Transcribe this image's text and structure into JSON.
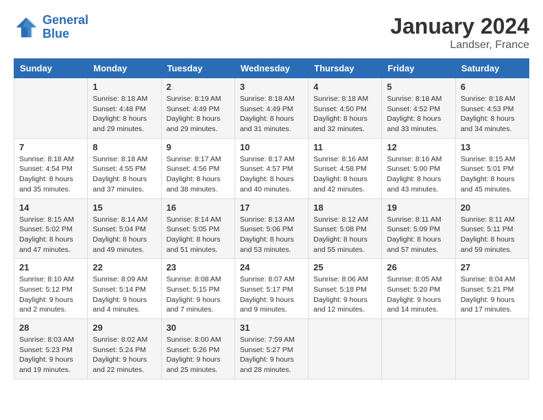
{
  "header": {
    "logo_line1": "General",
    "logo_line2": "Blue",
    "month": "January 2024",
    "location": "Landser, France"
  },
  "days_of_week": [
    "Sunday",
    "Monday",
    "Tuesday",
    "Wednesday",
    "Thursday",
    "Friday",
    "Saturday"
  ],
  "weeks": [
    [
      {
        "day": "",
        "info": ""
      },
      {
        "day": "1",
        "info": "Sunrise: 8:18 AM\nSunset: 4:48 PM\nDaylight: 8 hours\nand 29 minutes."
      },
      {
        "day": "2",
        "info": "Sunrise: 8:19 AM\nSunset: 4:49 PM\nDaylight: 8 hours\nand 29 minutes."
      },
      {
        "day": "3",
        "info": "Sunrise: 8:18 AM\nSunset: 4:49 PM\nDaylight: 8 hours\nand 31 minutes."
      },
      {
        "day": "4",
        "info": "Sunrise: 8:18 AM\nSunset: 4:50 PM\nDaylight: 8 hours\nand 32 minutes."
      },
      {
        "day": "5",
        "info": "Sunrise: 8:18 AM\nSunset: 4:52 PM\nDaylight: 8 hours\nand 33 minutes."
      },
      {
        "day": "6",
        "info": "Sunrise: 8:18 AM\nSunset: 4:53 PM\nDaylight: 8 hours\nand 34 minutes."
      }
    ],
    [
      {
        "day": "7",
        "info": "Sunrise: 8:18 AM\nSunset: 4:54 PM\nDaylight: 8 hours\nand 35 minutes."
      },
      {
        "day": "8",
        "info": "Sunrise: 8:18 AM\nSunset: 4:55 PM\nDaylight: 8 hours\nand 37 minutes."
      },
      {
        "day": "9",
        "info": "Sunrise: 8:17 AM\nSunset: 4:56 PM\nDaylight: 8 hours\nand 38 minutes."
      },
      {
        "day": "10",
        "info": "Sunrise: 8:17 AM\nSunset: 4:57 PM\nDaylight: 8 hours\nand 40 minutes."
      },
      {
        "day": "11",
        "info": "Sunrise: 8:16 AM\nSunset: 4:58 PM\nDaylight: 8 hours\nand 42 minutes."
      },
      {
        "day": "12",
        "info": "Sunrise: 8:16 AM\nSunset: 5:00 PM\nDaylight: 8 hours\nand 43 minutes."
      },
      {
        "day": "13",
        "info": "Sunrise: 8:15 AM\nSunset: 5:01 PM\nDaylight: 8 hours\nand 45 minutes."
      }
    ],
    [
      {
        "day": "14",
        "info": "Sunrise: 8:15 AM\nSunset: 5:02 PM\nDaylight: 8 hours\nand 47 minutes."
      },
      {
        "day": "15",
        "info": "Sunrise: 8:14 AM\nSunset: 5:04 PM\nDaylight: 8 hours\nand 49 minutes."
      },
      {
        "day": "16",
        "info": "Sunrise: 8:14 AM\nSunset: 5:05 PM\nDaylight: 8 hours\nand 51 minutes."
      },
      {
        "day": "17",
        "info": "Sunrise: 8:13 AM\nSunset: 5:06 PM\nDaylight: 8 hours\nand 53 minutes."
      },
      {
        "day": "18",
        "info": "Sunrise: 8:12 AM\nSunset: 5:08 PM\nDaylight: 8 hours\nand 55 minutes."
      },
      {
        "day": "19",
        "info": "Sunrise: 8:11 AM\nSunset: 5:09 PM\nDaylight: 8 hours\nand 57 minutes."
      },
      {
        "day": "20",
        "info": "Sunrise: 8:11 AM\nSunset: 5:11 PM\nDaylight: 8 hours\nand 59 minutes."
      }
    ],
    [
      {
        "day": "21",
        "info": "Sunrise: 8:10 AM\nSunset: 5:12 PM\nDaylight: 9 hours\nand 2 minutes."
      },
      {
        "day": "22",
        "info": "Sunrise: 8:09 AM\nSunset: 5:14 PM\nDaylight: 9 hours\nand 4 minutes."
      },
      {
        "day": "23",
        "info": "Sunrise: 8:08 AM\nSunset: 5:15 PM\nDaylight: 9 hours\nand 7 minutes."
      },
      {
        "day": "24",
        "info": "Sunrise: 8:07 AM\nSunset: 5:17 PM\nDaylight: 9 hours\nand 9 minutes."
      },
      {
        "day": "25",
        "info": "Sunrise: 8:06 AM\nSunset: 5:18 PM\nDaylight: 9 hours\nand 12 minutes."
      },
      {
        "day": "26",
        "info": "Sunrise: 8:05 AM\nSunset: 5:20 PM\nDaylight: 9 hours\nand 14 minutes."
      },
      {
        "day": "27",
        "info": "Sunrise: 8:04 AM\nSunset: 5:21 PM\nDaylight: 9 hours\nand 17 minutes."
      }
    ],
    [
      {
        "day": "28",
        "info": "Sunrise: 8:03 AM\nSunset: 5:23 PM\nDaylight: 9 hours\nand 19 minutes."
      },
      {
        "day": "29",
        "info": "Sunrise: 8:02 AM\nSunset: 5:24 PM\nDaylight: 9 hours\nand 22 minutes."
      },
      {
        "day": "30",
        "info": "Sunrise: 8:00 AM\nSunset: 5:26 PM\nDaylight: 9 hours\nand 25 minutes."
      },
      {
        "day": "31",
        "info": "Sunrise: 7:59 AM\nSunset: 5:27 PM\nDaylight: 9 hours\nand 28 minutes."
      },
      {
        "day": "",
        "info": ""
      },
      {
        "day": "",
        "info": ""
      },
      {
        "day": "",
        "info": ""
      }
    ]
  ]
}
